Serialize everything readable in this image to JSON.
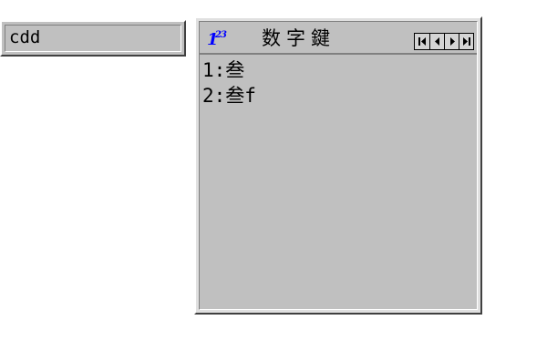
{
  "composition": {
    "text": "cdd"
  },
  "candidate_window": {
    "icon": "numeric-ime-icon",
    "title": "数字鍵",
    "pager": {
      "first": "first-page-icon",
      "prev": "prev-page-icon",
      "next": "next-page-icon",
      "last": "last-page-icon"
    },
    "candidates": [
      "1:叁",
      "2:叁f"
    ]
  },
  "colors": {
    "face": "#c0c0c0",
    "icon_blue": "#0000ff"
  }
}
